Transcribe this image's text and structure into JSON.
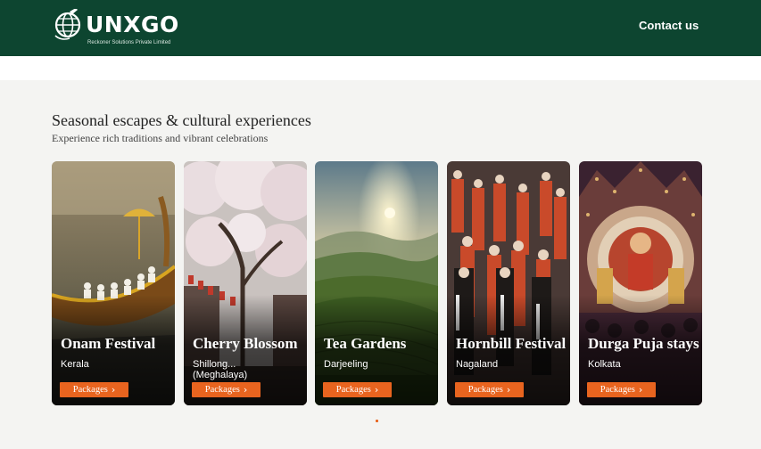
{
  "header": {
    "brand": "UNXGO",
    "brand_subtitle": "Reckoner Solutions Private Limited",
    "contact_label": "Contact us",
    "bg_color": "#0d4530"
  },
  "section": {
    "title": "Seasonal escapes & cultural experiences",
    "subtitle": "Experience rich traditions and vibrant celebrations"
  },
  "cards": [
    {
      "title": "Onam Festival",
      "location": "Kerala",
      "button": "Packages",
      "icon": "chevron-right-icon"
    },
    {
      "title": "Cherry Blossom",
      "location": "Shillong... (Meghalaya)",
      "button": "Packages",
      "icon": "chevron-right-icon"
    },
    {
      "title": "Tea Gardens",
      "location": "Darjeeling",
      "button": "Packages",
      "icon": "chevron-right-icon"
    },
    {
      "title": "Hornbill Festival",
      "location": "Nagaland",
      "button": "Packages",
      "icon": "chevron-right-icon"
    },
    {
      "title": "Durga Puja stays",
      "location": "Kolkata",
      "button": "Packages",
      "icon": "chevron-right-icon"
    }
  ],
  "accent_color": "#e8641f",
  "carousel": {
    "active_index": 0
  }
}
